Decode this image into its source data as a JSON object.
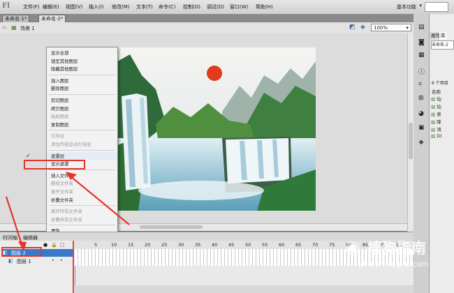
{
  "app": {
    "logo": "Fl",
    "menu": [
      "文件(F)",
      "编辑(E)",
      "视图(V)",
      "插入(I)",
      "修改(M)",
      "文本(T)",
      "命令(C)",
      "控制(O)",
      "调试(D)",
      "窗口(W)",
      "帮助(H)"
    ],
    "workspace": "基本功能"
  },
  "tabs": [
    "未命名-1*",
    "未命名-2*"
  ],
  "scene": {
    "label": "场景 1",
    "zoom": "100%"
  },
  "context_menu": {
    "items": [
      {
        "label": "显示全部",
        "disabled": false
      },
      {
        "label": "锁定其他图层",
        "disabled": false
      },
      {
        "label": "隐藏其他图层",
        "disabled": false
      },
      {
        "sep": true
      },
      {
        "label": "插入图层",
        "disabled": false
      },
      {
        "label": "删除图层",
        "disabled": false
      },
      {
        "sep": true
      },
      {
        "label": "剪切图层",
        "disabled": false
      },
      {
        "label": "拷贝图层",
        "disabled": false
      },
      {
        "label": "粘贴图层",
        "disabled": true
      },
      {
        "label": "复制图层",
        "disabled": false
      },
      {
        "sep": true
      },
      {
        "label": "引导层",
        "disabled": true
      },
      {
        "label": "添加传统运动引导层",
        "disabled": true
      },
      {
        "sep": true
      },
      {
        "label": "遮罩层",
        "disabled": false,
        "checked": true
      },
      {
        "label": "显示遮罩",
        "disabled": false
      },
      {
        "sep": true
      },
      {
        "label": "插入文件夹",
        "disabled": false
      },
      {
        "label": "删除文件夹",
        "disabled": true
      },
      {
        "label": "展开文件夹",
        "disabled": true
      },
      {
        "label": "折叠文件夹",
        "disabled": false
      },
      {
        "sep": true
      },
      {
        "label": "展开所有文件夹",
        "disabled": true
      },
      {
        "label": "折叠所有文件夹",
        "disabled": true
      },
      {
        "sep": true
      },
      {
        "label": "属性...",
        "disabled": false
      }
    ],
    "check_mark": "✓"
  },
  "timeline": {
    "tabs": [
      "时间轴",
      "编辑器"
    ],
    "frame_numbers": [
      "5",
      "10",
      "15",
      "20",
      "25",
      "30",
      "35",
      "40",
      "45",
      "50",
      "55",
      "60",
      "65",
      "70",
      "75",
      "80",
      "85",
      "90",
      "95"
    ],
    "layers": [
      {
        "name": "图层 2",
        "selected": true
      },
      {
        "name": "图层 1",
        "selected": false
      }
    ]
  },
  "right_panel": {
    "tabs": [
      "属性",
      "库"
    ],
    "doc_name": "未命名-2",
    "item_count": "6 个项目",
    "col_header": "名称",
    "library_items": [
      "仙",
      "仙",
      "甚",
      "降",
      "湾",
      "D("
    ]
  },
  "watermark": {
    "title": "搜狗指南",
    "url": "zhinan.sogou.com"
  },
  "colors": {
    "accent": "#e5352a",
    "selected_layer": "#3a78c9"
  }
}
